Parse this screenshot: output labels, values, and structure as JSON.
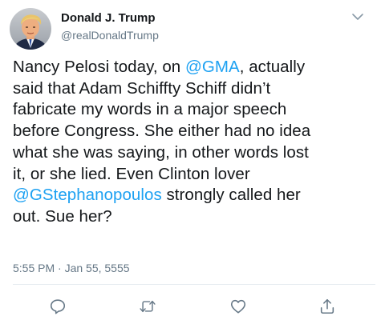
{
  "author": {
    "display_name": "Donald J. Trump",
    "handle": "@realDonaldTrump",
    "avatar": "profile-photo"
  },
  "tweet": {
    "lines": [
      {
        "segments": [
          {
            "text": "Nancy Pelosi today, on ",
            "type": "text"
          },
          {
            "text": "@GMA",
            "type": "mention"
          },
          {
            "text": ", actually",
            "type": "text"
          }
        ]
      },
      {
        "segments": [
          {
            "text": "said that Adam Schiffty Schiff didn’t",
            "type": "text"
          }
        ]
      },
      {
        "segments": [
          {
            "text": "fabricate my words in a major speech",
            "type": "text"
          }
        ]
      },
      {
        "segments": [
          {
            "text": "before Congress. She either had no idea",
            "type": "text"
          }
        ]
      },
      {
        "segments": [
          {
            "text": "what she was saying, in other words lost",
            "type": "text"
          }
        ]
      },
      {
        "segments": [
          {
            "text": "it, or she lied. Even Clinton lover",
            "type": "text"
          }
        ]
      },
      {
        "segments": [
          {
            "text": "@GStephanopoulos",
            "type": "mention"
          },
          {
            "text": " strongly called her",
            "type": "text"
          }
        ]
      },
      {
        "segments": [
          {
            "text": "out. Sue her?",
            "type": "text"
          }
        ]
      }
    ],
    "timestamp": "5:55 PM · Jan 55, 5555"
  },
  "icons": {
    "menu": "chevron-down-icon",
    "reply": "reply-icon",
    "retweet": "retweet-icon",
    "like": "heart-icon",
    "share": "share-icon"
  },
  "colors": {
    "text": "#14171a",
    "secondary": "#657786",
    "link": "#1da1f2",
    "divider": "#e6ecf0"
  }
}
